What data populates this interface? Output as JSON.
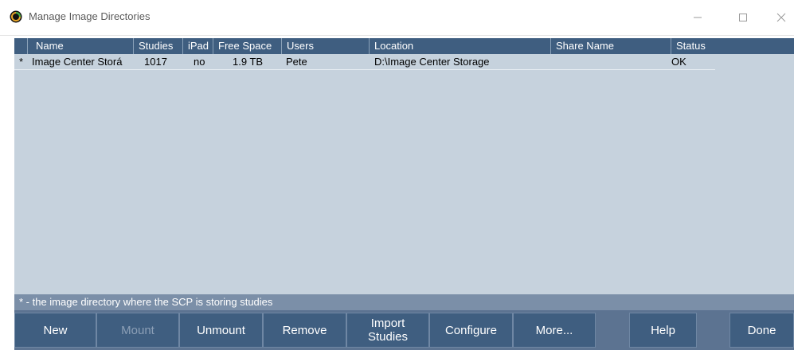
{
  "window": {
    "title": "Manage Image Directories",
    "controls": {
      "minimize_icon": "minimize-icon",
      "maximize_icon": "maximize-icon",
      "close_icon": "close-icon"
    }
  },
  "table": {
    "columns": [
      "Name",
      "Studies",
      "iPad",
      "Free Space",
      "Users",
      "Location",
      "Share Name",
      "Status"
    ],
    "rows": [
      {
        "marker": "*",
        "name": "Image Center Storá",
        "studies": "1017",
        "ipad": "no",
        "free_space": "1.9 TB",
        "users": "Pete",
        "location": "D:\\Image Center Storage",
        "share_name": "",
        "status": "OK"
      }
    ]
  },
  "footer_note": "* - the image directory where the SCP is storing studies",
  "buttons": {
    "new": "New",
    "mount": "Mount",
    "unmount": "Unmount",
    "remove": "Remove",
    "import_line1": "Import",
    "import_line2": "Studies",
    "configure": "Configure",
    "more": "More...",
    "help": "Help",
    "done": "Done"
  },
  "colors": {
    "header_bg": "#3f5e80",
    "grid_bg": "#c6d2dd",
    "button_bg": "#3f5e80",
    "disabled_text": "#8c9fb6"
  }
}
